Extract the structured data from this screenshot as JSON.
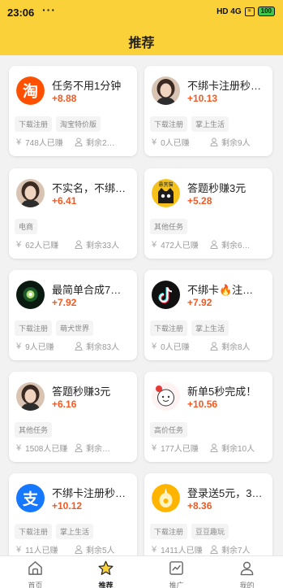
{
  "status_bar": {
    "time": "23:06",
    "dots": "···",
    "signal": "HD 4G",
    "wifi": "≈",
    "battery": "100"
  },
  "header": {
    "title": "推荐"
  },
  "tasks": [
    {
      "title": "任务不用1分钟",
      "price": "+8.88",
      "tags": [
        "下载注册",
        "淘宝特价版"
      ],
      "earned": "748人已赚",
      "remaining": "剩余2…",
      "avatar": "taobao-logo"
    },
    {
      "title": "不绑卡注册秒…",
      "price": "+10.13",
      "tags": [
        "下载注册",
        "掌上生活"
      ],
      "earned": "0人已赚",
      "remaining": "剩余9人",
      "avatar": "woman-photo"
    },
    {
      "title": "不实名，不绑…",
      "price": "+6.41",
      "tags": [
        "电商"
      ],
      "earned": "62人已赚",
      "remaining": "剩余33人",
      "avatar": "woman-photo"
    },
    {
      "title": "答题秒赚3元",
      "price": "+5.28",
      "tags": [
        "其他任务"
      ],
      "earned": "472人已赚",
      "remaining": "剩余6…",
      "avatar": "cat-logo",
      "avatar_text": "悬赏猫"
    },
    {
      "title": "最简单合成7…",
      "price": "+7.92",
      "tags": [
        "下载注册",
        "萌犬世界"
      ],
      "earned": "9人已赚",
      "remaining": "剩余83人",
      "avatar": "glow-photo"
    },
    {
      "title": "不绑卡🔥注…",
      "price": "+7.92",
      "tags": [
        "下载注册",
        "掌上生活"
      ],
      "earned": "0人已赚",
      "remaining": "剩余8人",
      "avatar": "tiktok-logo"
    },
    {
      "title": "答题秒赚3元",
      "price": "+6.16",
      "tags": [
        "其他任务"
      ],
      "earned": "1508人已赚",
      "remaining": "剩余…",
      "avatar": "woman-photo"
    },
    {
      "title": "新单5秒完成！",
      "price": "+10.56",
      "tags": [
        "高价任务"
      ],
      "earned": "177人已赚",
      "remaining": "剩余10人",
      "avatar": "cartoon-logo"
    },
    {
      "title": "不绑卡注册秒…",
      "price": "+10.12",
      "tags": [
        "下载注册",
        "掌上生活"
      ],
      "earned": "11人已赚",
      "remaining": "剩余5人",
      "avatar": "alipay-logo"
    },
    {
      "title": "登录送5元，3…",
      "price": "+8.36",
      "tags": [
        "下载注册",
        "豆豆趣玩"
      ],
      "earned": "1411人已赚",
      "remaining": "剩余7人",
      "avatar": "coin-logo"
    }
  ],
  "tabbar": {
    "items": [
      {
        "label": "首页",
        "icon": "home-icon"
      },
      {
        "label": "推荐",
        "icon": "star-icon",
        "active": true
      },
      {
        "label": "推广",
        "icon": "chart-icon"
      },
      {
        "label": "我的",
        "icon": "user-icon"
      }
    ]
  },
  "colors": {
    "brand": "#fbd13a",
    "price": "#f15a24",
    "text": "#222222",
    "muted": "#999999"
  }
}
